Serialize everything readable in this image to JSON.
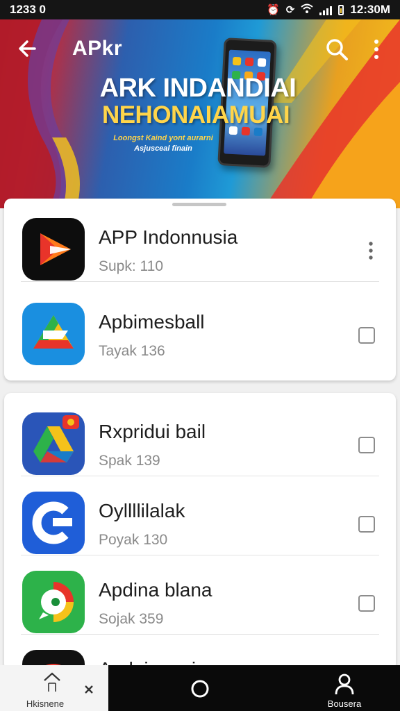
{
  "status_bar": {
    "left_text": "1233 0",
    "time": "12:30M",
    "icons": [
      "alarm-icon",
      "sync-icon",
      "wifi-icon",
      "signal-icon",
      "battery-icon"
    ]
  },
  "app_bar": {
    "title": "APkr",
    "back_icon": "arrow-left-icon",
    "search_icon": "search-icon",
    "menu_icon": "more-vertical-icon"
  },
  "hero": {
    "title_line1": "ARK INDANDIAI",
    "title_line2": "NEHONAIAMUAI",
    "subtitle_line1": "Loongst Kaind yont aurarni",
    "subtitle_line2": "Asjusceal finain",
    "colors": {
      "red": "#c41e2a",
      "blue": "#1a7cc8",
      "yellow": "#f5c21a"
    }
  },
  "apps": [
    {
      "name": "APP Indonnusia",
      "size": "Supk: 110",
      "action": "more",
      "icon": "play-arrow-app-icon"
    },
    {
      "name": "Apbimesball",
      "size": "Tayak 136",
      "action": "checkbox",
      "checked": false,
      "icon": "triangle-app-icon"
    },
    {
      "name": "Rxpridui bail",
      "size": "Spak 139",
      "action": "checkbox",
      "checked": false,
      "icon": "drive-app-icon"
    },
    {
      "name": "Oyllllilalak",
      "size": "Poyak 130",
      "action": "checkbox",
      "checked": false,
      "icon": "c-letter-app-icon"
    },
    {
      "name": "Apdina blana",
      "size": "Sojak 359",
      "action": "checkbox",
      "checked": false,
      "icon": "chat-app-icon"
    },
    {
      "name": "Apdainanpia",
      "size": "",
      "action": "checkbox",
      "icon": "red-app-icon"
    }
  ],
  "bottom_nav": {
    "home_label": "Hkisnene",
    "profile_label": "Bousera",
    "icons": [
      "home-icon",
      "close-icon",
      "circle-icon",
      "person-icon"
    ]
  }
}
